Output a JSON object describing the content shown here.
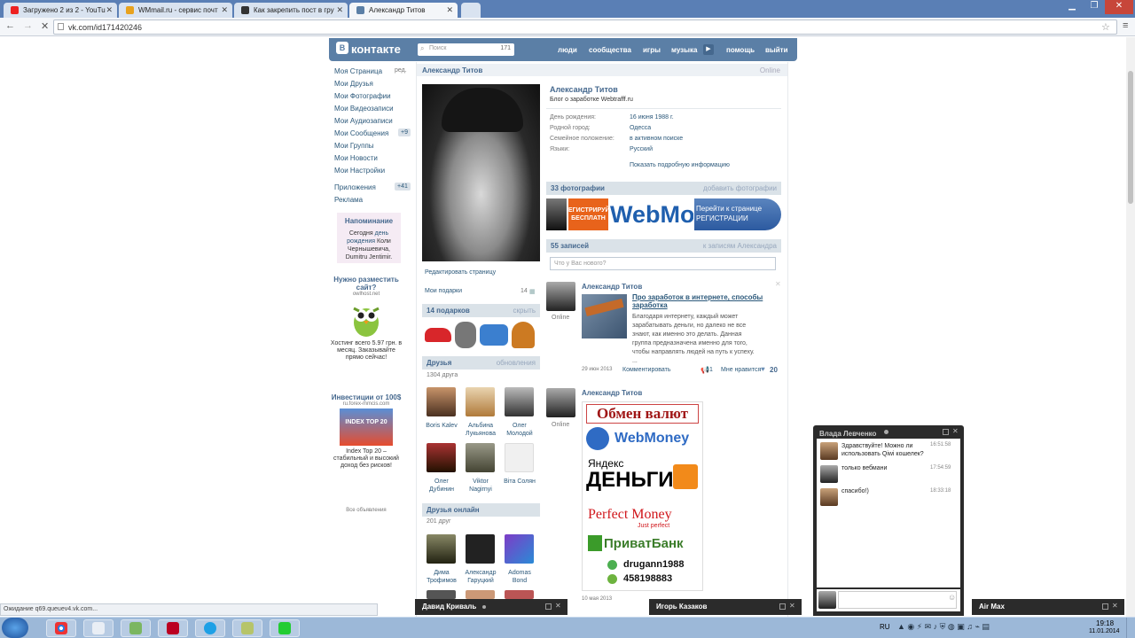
{
  "browser": {
    "tabs": [
      {
        "title": "Загружено 2 из 2 - YouTu",
        "fav": "#e22"
      },
      {
        "title": "WMmail.ru - сервис почт",
        "fav": "#e8a21d"
      },
      {
        "title": "Как закрепить пост в гру",
        "fav": "#333"
      },
      {
        "title": "Александр Титов",
        "fav": "#5b7fa6"
      }
    ],
    "url": "vk.com/id171420246",
    "status": "Ожидание q69.queuev4.vk.com..."
  },
  "vk": {
    "logo": "контакте",
    "search_placeholder": "Поиск",
    "search_count": "171",
    "nav": [
      "люди",
      "сообщества",
      "игры",
      "музыка",
      "помощь",
      "выйти"
    ],
    "left_menu": [
      {
        "label": "Моя Страница",
        "extra": "ред."
      },
      {
        "label": "Мои Друзья"
      },
      {
        "label": "Мои Фотографии"
      },
      {
        "label": "Мои Видеозаписи"
      },
      {
        "label": "Мои Аудиозаписи"
      },
      {
        "label": "Мои Сообщения",
        "badge": "+9"
      },
      {
        "label": "Мои Группы"
      },
      {
        "label": "Мои Новости"
      },
      {
        "label": "Мои Настройки"
      },
      {
        "label": "Приложения",
        "badge": "+41"
      },
      {
        "label": "Реклама"
      }
    ],
    "reminder": {
      "title": "Напоминание",
      "text1": "Сегодня",
      "link": "день рождения",
      "text2": "Коли Чернышевича, Dumitru Jentimir."
    },
    "ad1": {
      "title": "Нужно разместить сайт?",
      "domain": "owlhost.net",
      "text": "Хостинг всего 5.97 грн. в месяц. Заказывайте прямо сейчас!"
    },
    "ad2": {
      "title": "Инвестиции от 100$",
      "domain": "ru.forex-mmcis.com",
      "img_label": "INDEX TOP 20",
      "text": "Index Top 20 – стабильный и высокий доход без рисков!"
    },
    "all_ads": "Все объявления",
    "page_title": "Александр Титов",
    "online": "Online",
    "profile": {
      "name": "Александр Титов",
      "status": "Блог о заработке Webtrafff.ru",
      "fields": [
        {
          "k": "День рождения:",
          "v": "16 июня 1988 г."
        },
        {
          "k": "Родной город:",
          "v": "Одесса"
        },
        {
          "k": "Семейное положение:",
          "v": "в активном поиске"
        },
        {
          "k": "Языки:",
          "v": "Русский"
        }
      ],
      "more": "Показать подробную информацию"
    },
    "edit_page": "Редактировать страницу",
    "my_gifts": "Мои подарки",
    "my_gifts_count": "14",
    "gifts_bar": {
      "title": "14 подарков",
      "right": "скрыть"
    },
    "friends_bar": {
      "title": "Друзья",
      "right": "обновления"
    },
    "friends_count": "1304 друга",
    "friends": [
      {
        "name": "Boris Kalev"
      },
      {
        "name": "Альбина Лукьянова"
      },
      {
        "name": "Олег Молодой"
      },
      {
        "name": "Олег Дубинин"
      },
      {
        "name": "Viktor Nagirnyi"
      },
      {
        "name": "Віта Солян"
      }
    ],
    "online_bar": {
      "title": "Друзья онлайн"
    },
    "online_count": "201 друг",
    "online_friends": [
      {
        "name": "Дима Трофимов"
      },
      {
        "name": "Александр Гаруцкий"
      },
      {
        "name": "Adomas Bond"
      }
    ],
    "photos_bar": {
      "title": "33 фотографии",
      "right": "добавить фотографии"
    },
    "photo_labels": [
      "ЕГИСТРИРУЙ БЕСПЛАТН",
      "WebMo",
      "Перейти к странице РЕГИСТРАЦИИ"
    ],
    "wall_bar": {
      "title": "55 записей",
      "right": "к записям Александра"
    },
    "wall_placeholder": "Что у Вас нового?",
    "posts": [
      {
        "author": "Александр Титов",
        "online": "Online",
        "title": "Про заработок в интернете, способы заработка",
        "text": "Благодаря интернету, каждый может зарабатывать деньги, но далеко не все знают, как именно это делать. Данная группа предназначена именно для того, чтобы направлять людей на путь к успеху. ...",
        "date": "29 июн 2013",
        "comment": "Комментировать",
        "reposts": "1",
        "like_label": "Мне нравится",
        "likes": "20"
      },
      {
        "author": "Александр Титов",
        "online": "Online",
        "date": "10 мая 2013",
        "img": {
          "l1": "Обмен валют",
          "l2": "WebMoney",
          "l3": "Яндекс",
          "l4": "ДЕНЬГИ",
          "l5": "Perfect Money",
          "l6": "Just perfect",
          "l7": "ПриватБанк",
          "l8": "drugann1988",
          "l9": "458198883"
        }
      }
    ]
  },
  "chat": {
    "name": "Влада Левченко",
    "messages": [
      {
        "text": "Здравствуйте! Можно ли использовать Qiwi кошелек?",
        "time": "16:51:58"
      },
      {
        "text": "только вебмани",
        "time": "17:54:59"
      },
      {
        "text": "спасибо!)",
        "time": "18:33:18"
      }
    ],
    "bars": [
      "Давид Криваль",
      "Игорь Казаков",
      "Air Max"
    ]
  },
  "taskbar": {
    "lang": "RU",
    "time": "19:18",
    "date": "11.01.2014"
  }
}
